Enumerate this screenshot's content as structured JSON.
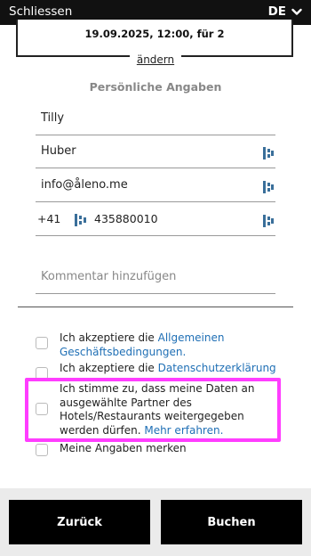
{
  "topbar": {
    "close_label": "Schliessen",
    "language": "DE"
  },
  "reservation": {
    "summary": "19.09.2025, 12:00, für 2",
    "change_label": "ändern"
  },
  "form": {
    "section_title": "Persönliche Angaben",
    "first_name": "Tilly",
    "last_name": "Huber",
    "email": "info@åleno.me",
    "phone_prefix": "+41",
    "phone_number": "435880010",
    "comment_placeholder": "Kommentar hinzufügen"
  },
  "consents": {
    "terms_prefix": "Ich akzeptiere die ",
    "terms_link": "Allgemeinen Geschäftsbedingungen.",
    "privacy_prefix": "Ich akzeptiere die ",
    "privacy_link": "Datenschutzerklärung",
    "partners_text": "Ich stimme zu, dass meine Daten an ausgewählte Partner des Hotels/Restaurants weitergegeben werden dürfen. ",
    "partners_link": "Mehr erfahren.",
    "remember_text": "Meine Angaben merken"
  },
  "footer": {
    "back_label": "Zurück",
    "book_label": "Buchen"
  },
  "colors": {
    "topbar": "#111111",
    "link": "#1f6fb5",
    "highlight": "#ff3dff",
    "button": "#000000",
    "footer": "#ebebeb",
    "password_manager_icon": "#3a6f9a"
  }
}
